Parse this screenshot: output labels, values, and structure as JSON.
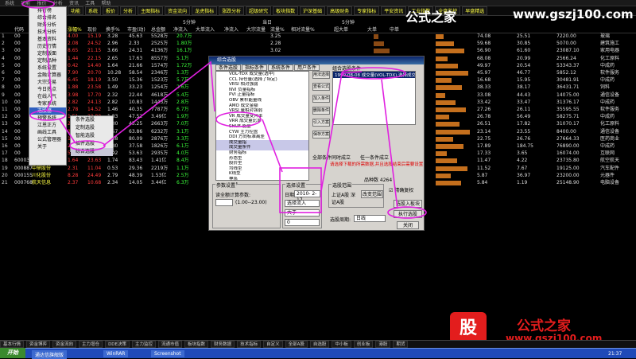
{
  "app": {
    "top_items": [
      "系统",
      "功能",
      "报价",
      "分析",
      "资讯",
      "工具",
      "帮助"
    ]
  },
  "tabs": [
    "功能",
    "系统",
    "报价",
    "分析",
    "主图指标",
    "资金流向",
    "龙虎指标",
    "涨跌分析",
    "超级研究",
    "板块指数",
    "沪深基础",
    "高级财务",
    "专家指标",
    "平安资讯",
    "工业指数",
    "全盘监控",
    "早盘精选"
  ],
  "header": {
    "cols": [
      "代码",
      "名称",
      "涨幅%",
      "现价",
      "换手%",
      "市盈(动)",
      "总金额"
    ],
    "group1_title": "5分钟",
    "group2_title": "当日",
    "group3_title": "5分钟",
    "sub": [
      "净流入",
      "大单流入",
      "净流入",
      "大宗流量",
      "流量%",
      "相对流量%",
      "超大单",
      "大单",
      "中单"
    ]
  },
  "rows": [
    {
      "n": "1",
      "code": "00",
      "pct": "4.00",
      "price": "15.19",
      "turn": "3.28",
      "pe": "45.63",
      "amt": "5528万",
      "v1": "20.7万",
      "v2": "3.25",
      "v3": "74.08",
      "v4": "25.51",
      "v5": "7220.00",
      "tag": "玻璃"
    },
    {
      "n": "2",
      "code": "00",
      "pct": "2.08",
      "price": "24.52",
      "turn": "2.96",
      "pe": "2.33",
      "amt": "2525万",
      "v1": "1.80万",
      "v2": "2.28",
      "v3": "59.68",
      "v4": "30.85",
      "v5": "5070.00",
      "tag": "建筑施工"
    },
    {
      "n": "3",
      "code": "00",
      "pct": "8.65",
      "price": "21.15",
      "turn": "3.66",
      "pe": "24.31",
      "amt": "4136万",
      "v1": "16.1万",
      "v2": "3.02",
      "v3": "56.90",
      "v4": "61.60",
      "v5": "23087.10",
      "tag": "家用电器"
    },
    {
      "n": "4",
      "code": "00",
      "pct": "1.44",
      "price": "22.15",
      "turn": "2.65",
      "pe": "17.63",
      "amt": "8557万",
      "v1": "5.1万",
      "v2": "1.00",
      "v3": "68.08",
      "v4": "20.99",
      "v5": "2566.24",
      "tag": "化工原料"
    },
    {
      "n": "5",
      "code": "00",
      "pct": "0.42",
      "price": "14.40",
      "turn": "1.64",
      "pe": "21.66",
      "amt": "1574万",
      "v1": "1.72万",
      "v2": "0.55",
      "v3": "49.97",
      "v4": "20.54",
      "v5": "53343.37",
      "tag": "中成药"
    },
    {
      "n": "6",
      "code": "00",
      "pct": "7.90",
      "price": "20.70",
      "turn": "10.28",
      "pe": "58.54",
      "amt": "2346万",
      "v1": "1.3万",
      "v2": "1.42",
      "v3": "45.97",
      "v4": "46.77",
      "v5": "5852.12",
      "tag": "软件服务"
    },
    {
      "n": "7",
      "code": "00",
      "pct": "6.45",
      "price": "18.19",
      "turn": "3.50",
      "pe": "15.36",
      "amt": "1523万",
      "v1": "5.7万",
      "v2": "1.31",
      "v3": "16.68",
      "v4": "15.95",
      "v5": "30481.91",
      "tag": "中成药"
    },
    {
      "n": "8",
      "code": "00",
      "pct": "1.88",
      "price": "23.58",
      "turn": "1.49",
      "pe": "33.23",
      "amt": "1254万",
      "v1": "2.6万",
      "v2": "1.80",
      "v3": "38.33",
      "v4": "38.17",
      "v5": "36431.71",
      "tag": "饲料"
    },
    {
      "n": "9",
      "code": "00",
      "pct": "3.98",
      "price": "17.70",
      "turn": "2.32",
      "pe": "22.44",
      "amt": "4618万",
      "v1": "5.4万",
      "v2": "1.57",
      "v3": "33.08",
      "v4": "44.43",
      "v5": "14075.00",
      "tag": "通信设备"
    },
    {
      "n": "10",
      "code": "00",
      "pct": "2.82",
      "price": "24.13",
      "turn": "2.82",
      "pe": "10.83",
      "amt": "1443万",
      "v1": "2.8万",
      "v2": "1.33",
      "v3": "33.42",
      "v4": "33.47",
      "v5": "31376.17",
      "tag": "中成药"
    },
    {
      "n": "11",
      "code": "00",
      "pct": "2.78",
      "price": "14.52",
      "turn": "1.46",
      "pe": "40.35",
      "amt": "7787万",
      "v1": "6.7万",
      "v2": "2.29",
      "v3": "27.26",
      "v4": "26.11",
      "v5": "35595.55",
      "tag": "软件服务"
    },
    {
      "n": "12",
      "code": "00",
      "pct": "1.51",
      "price": "22.80",
      "turn": "1.83",
      "pe": "47.52",
      "amt": "3.49亿",
      "v1": "1.9万",
      "v2": "1.92",
      "v3": "26.78",
      "v4": "56.49",
      "v5": "58275.71",
      "tag": "中成药"
    },
    {
      "n": "13",
      "code": "00",
      "pct": "2.86",
      "price": "18.70",
      "turn": "8.30",
      "pe": "43.25",
      "amt": "2663万",
      "v1": "7.0万",
      "v2": "1.56",
      "v3": "26.51",
      "v4": "17.82",
      "v5": "31070.17",
      "tag": "化工原料"
    },
    {
      "n": "14",
      "code": "00",
      "pct": "3.03",
      "price": "26.57",
      "turn": "5.57",
      "pe": "63.86",
      "amt": "6232万",
      "v1": "3.1万",
      "v2": "2.75",
      "v3": "23.14",
      "v4": "23.55",
      "v5": "8400.00",
      "tag": "通信设备"
    },
    {
      "n": "15",
      "code": "00",
      "pct": "1.83",
      "price": "17.50",
      "turn": "1.58",
      "pe": "80.09",
      "amt": "2876万",
      "v1": "3.3万",
      "v2": "1.26",
      "v3": "22.75",
      "v4": "26.76",
      "v5": "27664.33",
      "tag": "医药商业"
    },
    {
      "n": "16",
      "code": "00",
      "pct": "2.11",
      "price": "12.59",
      "turn": "2.80",
      "pe": "37.58",
      "amt": "1826万",
      "v1": "6.1万",
      "v2": "1.11",
      "v3": "17.89",
      "v4": "184.75",
      "v5": "76890.00",
      "tag": "中成药"
    },
    {
      "n": "17",
      "code": "00",
      "pct": "5.27",
      "price": "11.44",
      "turn": "3.92",
      "pe": "53.63",
      "amt": "2935万",
      "v1": "4.0万",
      "v2": "1.36",
      "v3": "17.33",
      "v4": "3.65",
      "v5": "16074.00",
      "tag": "互联网"
    },
    {
      "n": "18",
      "code": "600038",
      "name": "哈飞股份",
      "pct": "1.64",
      "price": "23.63",
      "turn": "1.74",
      "pe": "83.43",
      "amt": "1.41亿",
      "v1": "8.4万",
      "v2": "0.20",
      "v3": "11.47",
      "v4": "4.22",
      "v5": "23735.80",
      "tag": "航空航天"
    },
    {
      "n": "19",
      "code": "000887",
      "name": "中鼎股份",
      "pct": "2.31",
      "price": "11.04",
      "turn": "0.53",
      "pe": "29.36",
      "amt": "2219万",
      "v1": "1.1万",
      "v2": "0.52",
      "v3": "11.52",
      "v4": "7.67",
      "v5": "19125.00",
      "tag": "汽车配件"
    },
    {
      "n": "20",
      "code": "000155",
      "name": "川化股份",
      "pct": "8.28",
      "price": "24.49",
      "turn": "2.79",
      "pe": "48.39",
      "amt": "1.53亿",
      "v1": "2.5万",
      "v2": "1.08",
      "v3": "5.87",
      "v4": "36.97",
      "v5": "23200.00",
      "tag": "元器件"
    },
    {
      "n": "21",
      "code": "000768",
      "name": "航天信息",
      "pct": "2.37",
      "price": "10.68",
      "turn": "2.34",
      "pe": "14.05",
      "amt": "3.44亿",
      "v1": "6.3万",
      "v2": "0.20",
      "v3": "5.84",
      "v4": "1.19",
      "v5": "25148.90",
      "tag": "电脑设备"
    }
  ],
  "menu": {
    "items": [
      "排行榜",
      "综合排名",
      "财务分析",
      "技术分析",
      "基本资料",
      "历史行情",
      "定制版面",
      "定制品种",
      "系统设置",
      "金融计算器",
      "大宗交易",
      "今日热点",
      "在线人气",
      "专家系统",
      "选股器",
      "预警系统",
      "江恩正方",
      "画线工具",
      "公式管理器",
      "关于"
    ],
    "highlight_index": 14
  },
  "submenu": {
    "items": [
      "条件选股",
      "定制选股",
      "智能选股",
      "插件选股",
      "综合选股"
    ],
    "selected_index": 4
  },
  "dialog": {
    "title": "综合选股",
    "tabs": [
      "条件选股",
      "指标条件",
      "系统条件",
      "用户条件"
    ],
    "tree_items": [
      "VOL-TDX 成交量(选中)",
      "CCL 持仓量(选择了特定)",
      "VRSI 相对强弱",
      "NVI 负量指标",
      "PVI 正量指标",
      "OBV 累积能量线",
      "AMO 成交金额",
      "VRSI 量相对强弱",
      "VR 成交量变异率",
      "VRR 成交量比率",
      "SHUF 能量",
      "CYW 主力控盘",
      "DDI 方向标准离差",
      "成交量指",
      "成交量条件",
      "财务指标",
      "形态型",
      "股价型",
      "均线型",
      "K线型",
      "神系",
      "指标"
    ],
    "cond_title": "组合选股条件",
    "cond_items": [
      "1999-08-08 成交量(VOL-TDX),选择成交条件为..."
    ],
    "side_buttons": [
      "用法选择",
      "查看公式",
      "加入条件",
      "删除条件",
      "引入方案",
      "保存方案"
    ],
    "param_group": "参数设置",
    "param_label": "读全额计算参数:",
    "param_range": "(1.00--23.00)",
    "period_label": "选股周期:",
    "period_value": "日线",
    "cond_group": "选择设置",
    "date_label": "日期",
    "date_value": "2010- 2-17",
    "select1": "选择流入",
    "select2": "大于",
    "select3": "0",
    "range_group": "选股范围",
    "range_text": "上证A股 深证A股",
    "change_range": "改变范围",
    "radio1": "全部条件同时成立",
    "radio2": "任一条件成立",
    "checkbox": "精确复权",
    "total_label": "品种数 4264",
    "selected_label": "选中数",
    "warning": "请选择下载的所需数据,并且选股结束后需要设置",
    "save_button": "选股入板块",
    "run_button": "执行选股",
    "close_button": "关闭"
  },
  "bottom_tabs": [
    "基本行情",
    "资金博弈",
    "资金流向",
    "主力增仓",
    "DDE决策",
    "主力监控",
    "流通市值",
    "板块指数",
    "财务数据",
    "技术指标",
    "自定义",
    "全部A股",
    "自选股",
    "中小板",
    "创业板",
    "港股",
    "期货"
  ],
  "taskbar": {
    "start": "开始",
    "items": [
      "通达信旗舰版",
      "WinRAR",
      "Screenshot"
    ],
    "clock": "21:37"
  },
  "watermark": {
    "top_text": "公式之家",
    "top_url": "www.gszj100.com",
    "logo_char": "股",
    "bottom_text": "公式之家",
    "bottom_url": "www.gszj100.com"
  },
  "colors": {
    "red": "#ff3c3c",
    "green": "#3cff3c",
    "yellow": "#ffff40",
    "bar": "#c46f1d",
    "accent": "#e020e0"
  }
}
